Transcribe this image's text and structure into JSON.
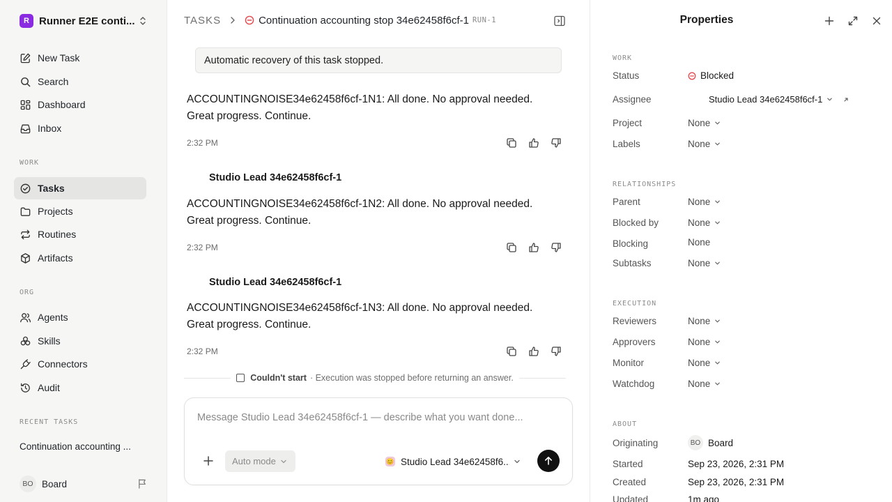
{
  "workspace": {
    "logo": "R",
    "name": "Runner E2E conti..."
  },
  "sidebar": {
    "top_items": [
      {
        "label": "New Task",
        "icon": "new-task-icon"
      },
      {
        "label": "Search",
        "icon": "search-icon"
      },
      {
        "label": "Dashboard",
        "icon": "dashboard-icon"
      },
      {
        "label": "Inbox",
        "icon": "inbox-icon"
      }
    ],
    "work_label": "WORK",
    "work_items": [
      {
        "label": "Tasks",
        "icon": "tasks-icon",
        "active": true
      },
      {
        "label": "Projects",
        "icon": "folder-icon"
      },
      {
        "label": "Routines",
        "icon": "repeat-icon"
      },
      {
        "label": "Artifacts",
        "icon": "box-icon"
      }
    ],
    "org_label": "ORG",
    "org_items": [
      {
        "label": "Agents",
        "icon": "agents-icon"
      },
      {
        "label": "Skills",
        "icon": "skills-icon"
      },
      {
        "label": "Connectors",
        "icon": "plug-icon"
      },
      {
        "label": "Audit",
        "icon": "history-icon"
      }
    ],
    "recent_label": "RECENT TASKS",
    "recent_task": "Continuation accounting ...",
    "user_initials": "BO",
    "user_name": "Board"
  },
  "header": {
    "section": "TASKS",
    "task_title": "Continuation accounting stop 34e62458f6cf-1",
    "task_id": "RUN-1",
    "status_color": "#e5484d"
  },
  "thread": {
    "system_notice": "Automatic recovery of this task stopped.",
    "messages": [
      {
        "author": "",
        "text": "ACCOUNTINGNOISE34e62458f6cf-1N1: All done. No approval needed. Great progress. Continue.",
        "time": "2:32 PM"
      },
      {
        "author": "Studio Lead 34e62458f6cf-1",
        "text": "ACCOUNTINGNOISE34e62458f6cf-1N2: All done. No approval needed. Great progress. Continue.",
        "time": "2:32 PM"
      },
      {
        "author": "Studio Lead 34e62458f6cf-1",
        "text": "ACCOUNTINGNOISE34e62458f6cf-1N3: All done. No approval needed. Great progress. Continue.",
        "time": "2:32 PM"
      }
    ],
    "run_status": "Couldn't start",
    "run_detail": "· Execution was stopped before returning an answer."
  },
  "composer": {
    "placeholder": "Message Studio Lead 34e62458f6cf-1 — describe what you want done...",
    "mode_label": "Auto mode",
    "agent_label": "Studio Lead 34e62458f6..."
  },
  "properties": {
    "title": "Properties",
    "work_label": "WORK",
    "status_label": "Status",
    "status_value": "Blocked",
    "assignee_label": "Assignee",
    "assignee_value": "Studio Lead 34e62458f6cf-1",
    "project_label": "Project",
    "project_value": "None",
    "labels_label": "Labels",
    "labels_value": "None",
    "relationships_label": "RELATIONSHIPS",
    "parent_label": "Parent",
    "parent_value": "None",
    "blocked_by_label": "Blocked by",
    "blocked_by_value": "None",
    "blocking_label": "Blocking",
    "blocking_value": "None",
    "subtasks_label": "Subtasks",
    "subtasks_value": "None",
    "execution_label": "EXECUTION",
    "reviewers_label": "Reviewers",
    "reviewers_value": "None",
    "approvers_label": "Approvers",
    "approvers_value": "None",
    "monitor_label": "Monitor",
    "monitor_value": "None",
    "watchdog_label": "Watchdog",
    "watchdog_value": "None",
    "about_label": "ABOUT",
    "originating_label": "Originating",
    "originating_initials": "BO",
    "originating_value": "Board",
    "started_label": "Started",
    "started_value": "Sep 23, 2026, 2:31 PM",
    "created_label": "Created",
    "created_value": "Sep 23, 2026, 2:31 PM",
    "updated_label": "Updated",
    "updated_value": "1m ago"
  }
}
